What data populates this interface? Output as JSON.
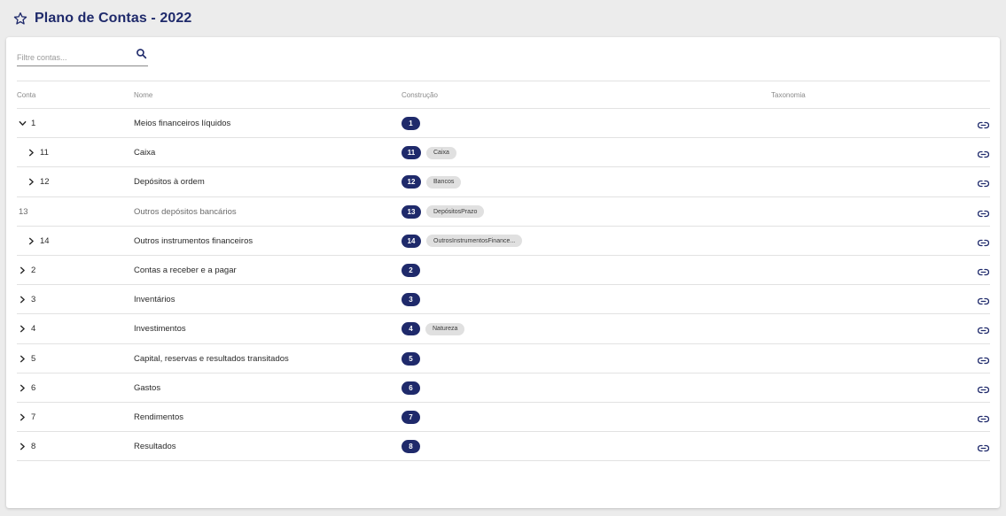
{
  "header": {
    "title": "Plano de Contas - 2022"
  },
  "search": {
    "placeholder": "Filtre contas..."
  },
  "columns": {
    "conta": "Conta",
    "nome": "Nome",
    "construcao": "Construção",
    "taxonomia": "Taxonomia"
  },
  "rows": [
    {
      "conta": "1",
      "nome": "Meios financeiros líquidos",
      "badge": "1",
      "tag": "",
      "chevron": "chevron-down",
      "indent": 0,
      "muted": false
    },
    {
      "conta": "11",
      "nome": "Caixa",
      "badge": "11",
      "tag": "Caixa",
      "chevron": "chevron-right",
      "indent": 1,
      "muted": false
    },
    {
      "conta": "12",
      "nome": "Depósitos à ordem",
      "badge": "12",
      "tag": "Bancos",
      "chevron": "chevron-right",
      "indent": 1,
      "muted": false
    },
    {
      "conta": "13",
      "nome": "Outros depósitos bancários",
      "badge": "13",
      "tag": "DepósitosPrazo",
      "chevron": "none",
      "indent": 1,
      "muted": true
    },
    {
      "conta": "14",
      "nome": "Outros instrumentos financeiros",
      "badge": "14",
      "tag": "OutrosInstrumentosFinance...",
      "chevron": "chevron-right",
      "indent": 1,
      "muted": false
    },
    {
      "conta": "2",
      "nome": "Contas a receber e a pagar",
      "badge": "2",
      "tag": "",
      "chevron": "chevron-right",
      "indent": 0,
      "muted": false
    },
    {
      "conta": "3",
      "nome": "Inventários",
      "badge": "3",
      "tag": "",
      "chevron": "chevron-right",
      "indent": 0,
      "muted": false
    },
    {
      "conta": "4",
      "nome": "Investimentos",
      "badge": "4",
      "tag": "Natureza",
      "chevron": "chevron-right",
      "indent": 0,
      "muted": false
    },
    {
      "conta": "5",
      "nome": "Capital, reservas e resultados transitados",
      "badge": "5",
      "tag": "",
      "chevron": "chevron-right",
      "indent": 0,
      "muted": false
    },
    {
      "conta": "6",
      "nome": "Gastos",
      "badge": "6",
      "tag": "",
      "chevron": "chevron-right",
      "indent": 0,
      "muted": false
    },
    {
      "conta": "7",
      "nome": "Rendimentos",
      "badge": "7",
      "tag": "",
      "chevron": "chevron-right",
      "indent": 0,
      "muted": false
    },
    {
      "conta": "8",
      "nome": "Resultados",
      "badge": "8",
      "tag": "",
      "chevron": "chevron-right",
      "indent": 0,
      "muted": false
    }
  ],
  "icons": {
    "title": "star-icon",
    "search": "search-icon",
    "row_action": "link-icon"
  },
  "colors": {
    "accent": "#1f2a6b",
    "tag_bg": "#e0e0e0",
    "page_bg": "#ececec"
  }
}
